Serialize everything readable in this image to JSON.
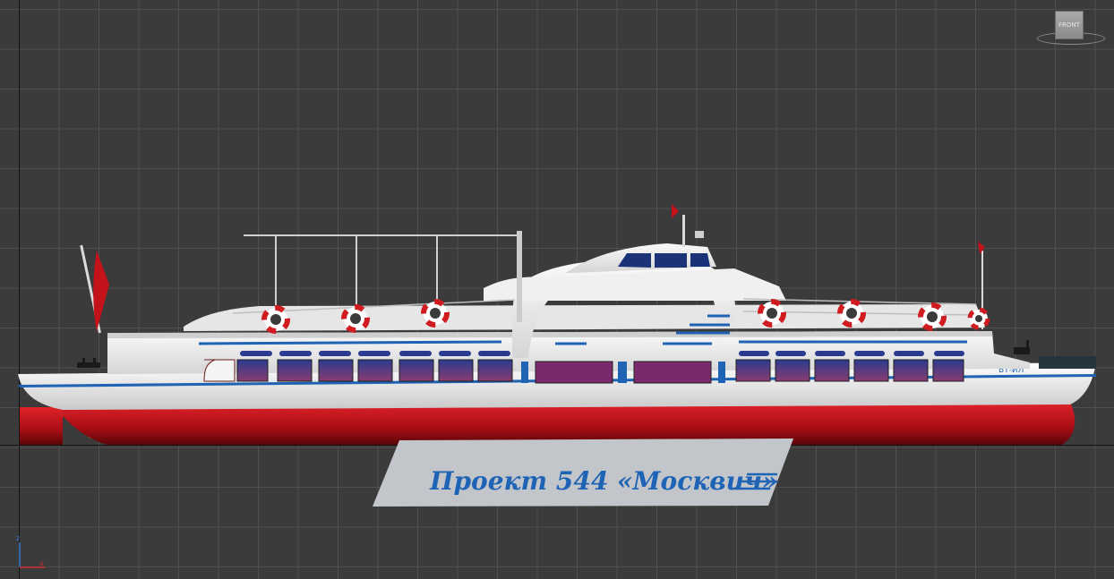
{
  "viewport": {
    "view_name": "FRONT",
    "grid": true,
    "colors": {
      "background": "#3b3b3b",
      "grid_line": "#4f4f4f",
      "hull_red": "#c4121a",
      "hull_white": "#eeeeee",
      "accent_blue": "#1f63b5"
    }
  },
  "viewcube": {
    "label": "FRONT"
  },
  "axis_tripod": {
    "x_label": "x",
    "z_label": "z"
  },
  "model": {
    "bow_number": "ВТ-ИЛ"
  },
  "plaque": {
    "title": "Проект 544 «Москвич»"
  }
}
